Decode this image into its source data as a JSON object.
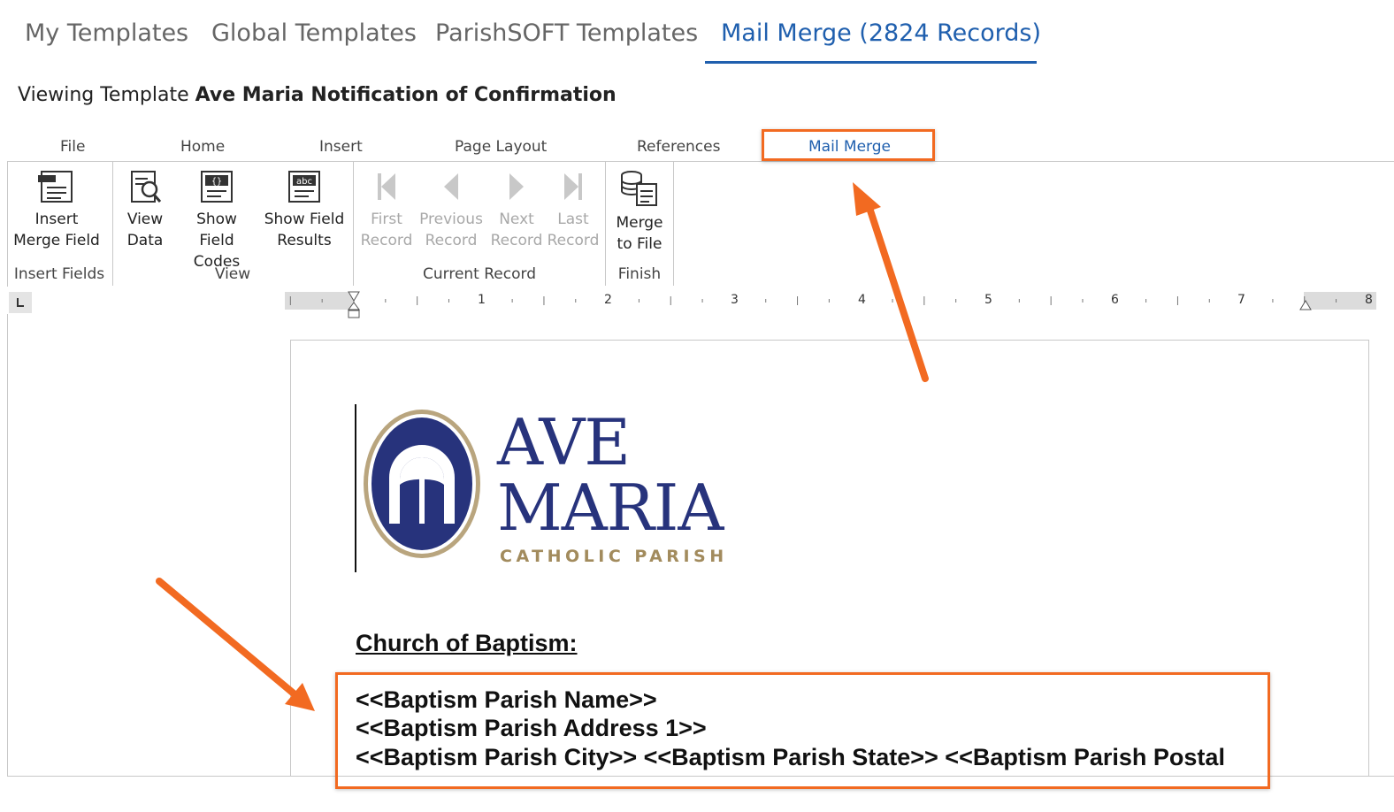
{
  "top_tabs": [
    {
      "label": "My Templates",
      "active": false
    },
    {
      "label": "Global Templates",
      "active": false
    },
    {
      "label": "ParishSOFT Templates",
      "active": false
    },
    {
      "label": "Mail Merge (2824 Records)",
      "active": true
    }
  ],
  "viewing": {
    "prefix": "Viewing Template",
    "template_name": "Ave Maria Notification of Confirmation"
  },
  "ribbon_tabs": [
    "File",
    "Home",
    "Insert",
    "Page Layout",
    "References",
    "Mail Merge"
  ],
  "ribbon_active_tab": "Mail Merge",
  "ribbon_groups": [
    {
      "label": "Insert Fields",
      "buttons": [
        {
          "label": "Insert\nMerge Field",
          "icon": "insert-merge-field-icon",
          "enabled": true
        }
      ]
    },
    {
      "label": "View",
      "buttons": [
        {
          "label": "View\nData",
          "icon": "view-data-icon",
          "enabled": true
        },
        {
          "label": "Show Field\nCodes",
          "icon": "field-codes-icon",
          "enabled": true
        },
        {
          "label": "Show Field\nResults",
          "icon": "field-results-icon",
          "enabled": true
        }
      ]
    },
    {
      "label": "Current Record",
      "buttons": [
        {
          "label": "First\nRecord",
          "icon": "first-record-icon",
          "enabled": false
        },
        {
          "label": "Previous\nRecord",
          "icon": "previous-record-icon",
          "enabled": false
        },
        {
          "label": "Next\nRecord",
          "icon": "next-record-icon",
          "enabled": false
        },
        {
          "label": "Last\nRecord",
          "icon": "last-record-icon",
          "enabled": false
        }
      ]
    },
    {
      "label": "Finish",
      "buttons": [
        {
          "label": "Merge\nto File",
          "icon": "merge-to-file-icon",
          "enabled": true
        }
      ]
    }
  ],
  "ruler_numbers": [
    "1",
    "2",
    "3",
    "4",
    "5",
    "6",
    "7",
    "8"
  ],
  "document": {
    "logo": {
      "line1": "AVE",
      "line2": "MARIA",
      "subtitle": "CATHOLIC PARISH"
    },
    "heading": "Church of Baptism:",
    "merge_lines": [
      "<<Baptism Parish Name>>",
      "<<Baptism Parish Address 1>>",
      "<<Baptism Parish City>> <<Baptism Parish State>> <<Baptism Parish Postal"
    ]
  },
  "colors": {
    "accent": "#1f5fae",
    "highlight": "#f26a21",
    "logo_blue": "#27337c",
    "logo_gold": "#a28b5d"
  }
}
